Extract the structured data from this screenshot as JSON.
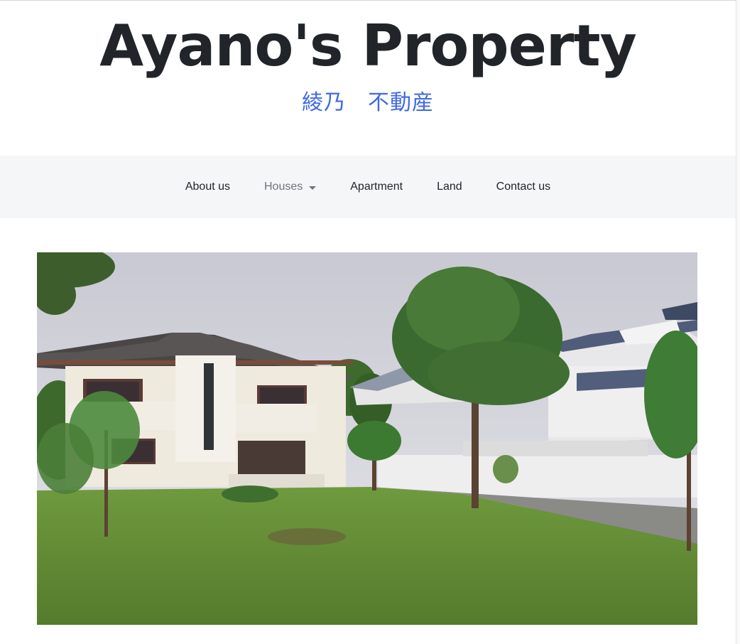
{
  "site": {
    "title": "Ayano's Property",
    "subtitle": "綾乃　不動産"
  },
  "nav": {
    "items": [
      {
        "label": "About us"
      },
      {
        "label": "Houses",
        "has_dropdown": true
      },
      {
        "label": "Apartment"
      },
      {
        "label": "Land"
      },
      {
        "label": "Contact us"
      }
    ]
  },
  "hero": {
    "alt": "photo of a two-story white house with a lawn and trees"
  },
  "colors": {
    "title": "#212529",
    "subtitle": "#4169e1",
    "navbar_bg": "#f5f6f8",
    "dropdown_text": "#6c757d"
  }
}
